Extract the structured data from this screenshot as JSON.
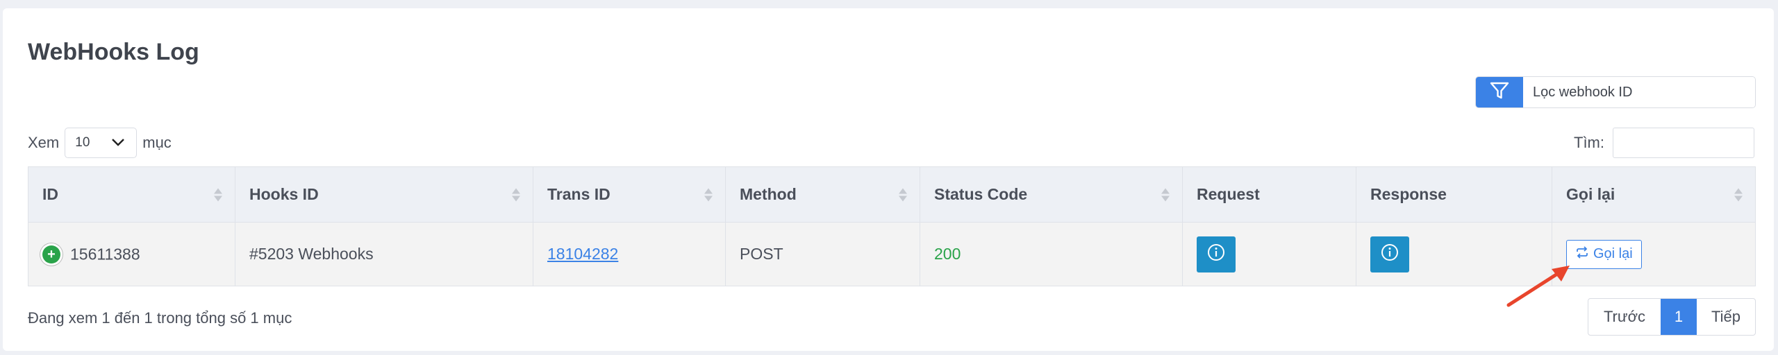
{
  "title": "WebHooks Log",
  "filter": {
    "icon": "filter-icon",
    "placeholder": "Lọc webhook ID"
  },
  "length": {
    "prefix": "Xem",
    "value": "10",
    "suffix": "mục"
  },
  "search": {
    "label": "Tìm:"
  },
  "table": {
    "columns": [
      "ID",
      "Hooks ID",
      "Trans ID",
      "Method",
      "Status Code",
      "Request",
      "Response",
      "Gọi lại"
    ],
    "rows": [
      {
        "id": "15611388",
        "hooks_id": "#5203 Webhooks",
        "trans_id": "18104282",
        "method": "POST",
        "status_code": "200",
        "retry_label": "Gọi lại"
      }
    ]
  },
  "footer": {
    "info": "Đang xem 1 đến 1 trong tổng số 1 mục"
  },
  "pagination": {
    "prev": "Trước",
    "current": "1",
    "next": "Tiếp"
  },
  "colors": {
    "accent": "#3b82e6",
    "success": "#2aa34a",
    "info": "#1e8fc7",
    "arrow": "#e8452c"
  }
}
